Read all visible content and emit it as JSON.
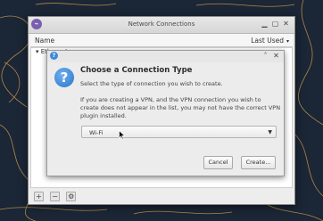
{
  "desktop": {
    "colors": {
      "background": "#1b2636",
      "contour_lines": "#d6a04a"
    }
  },
  "window": {
    "title": "Network Connections",
    "header": {
      "name_label": "Name",
      "last_used_label": "Last Used"
    },
    "list_group_label": "Ethernet",
    "toolbar": {
      "add_label": "+",
      "remove_label": "−",
      "settings_icon": "gear-icon"
    }
  },
  "dialog": {
    "heading": "Choose a Connection Type",
    "subtitle": "Select the type of connection you wish to create.",
    "note": "If you are creating a VPN, and the VPN connection you wish to create does not appear in the list, you may not have the correct VPN plugin installed.",
    "selected_type": "Wi-Fi",
    "cancel_label": "Cancel",
    "create_label": "Create..."
  }
}
